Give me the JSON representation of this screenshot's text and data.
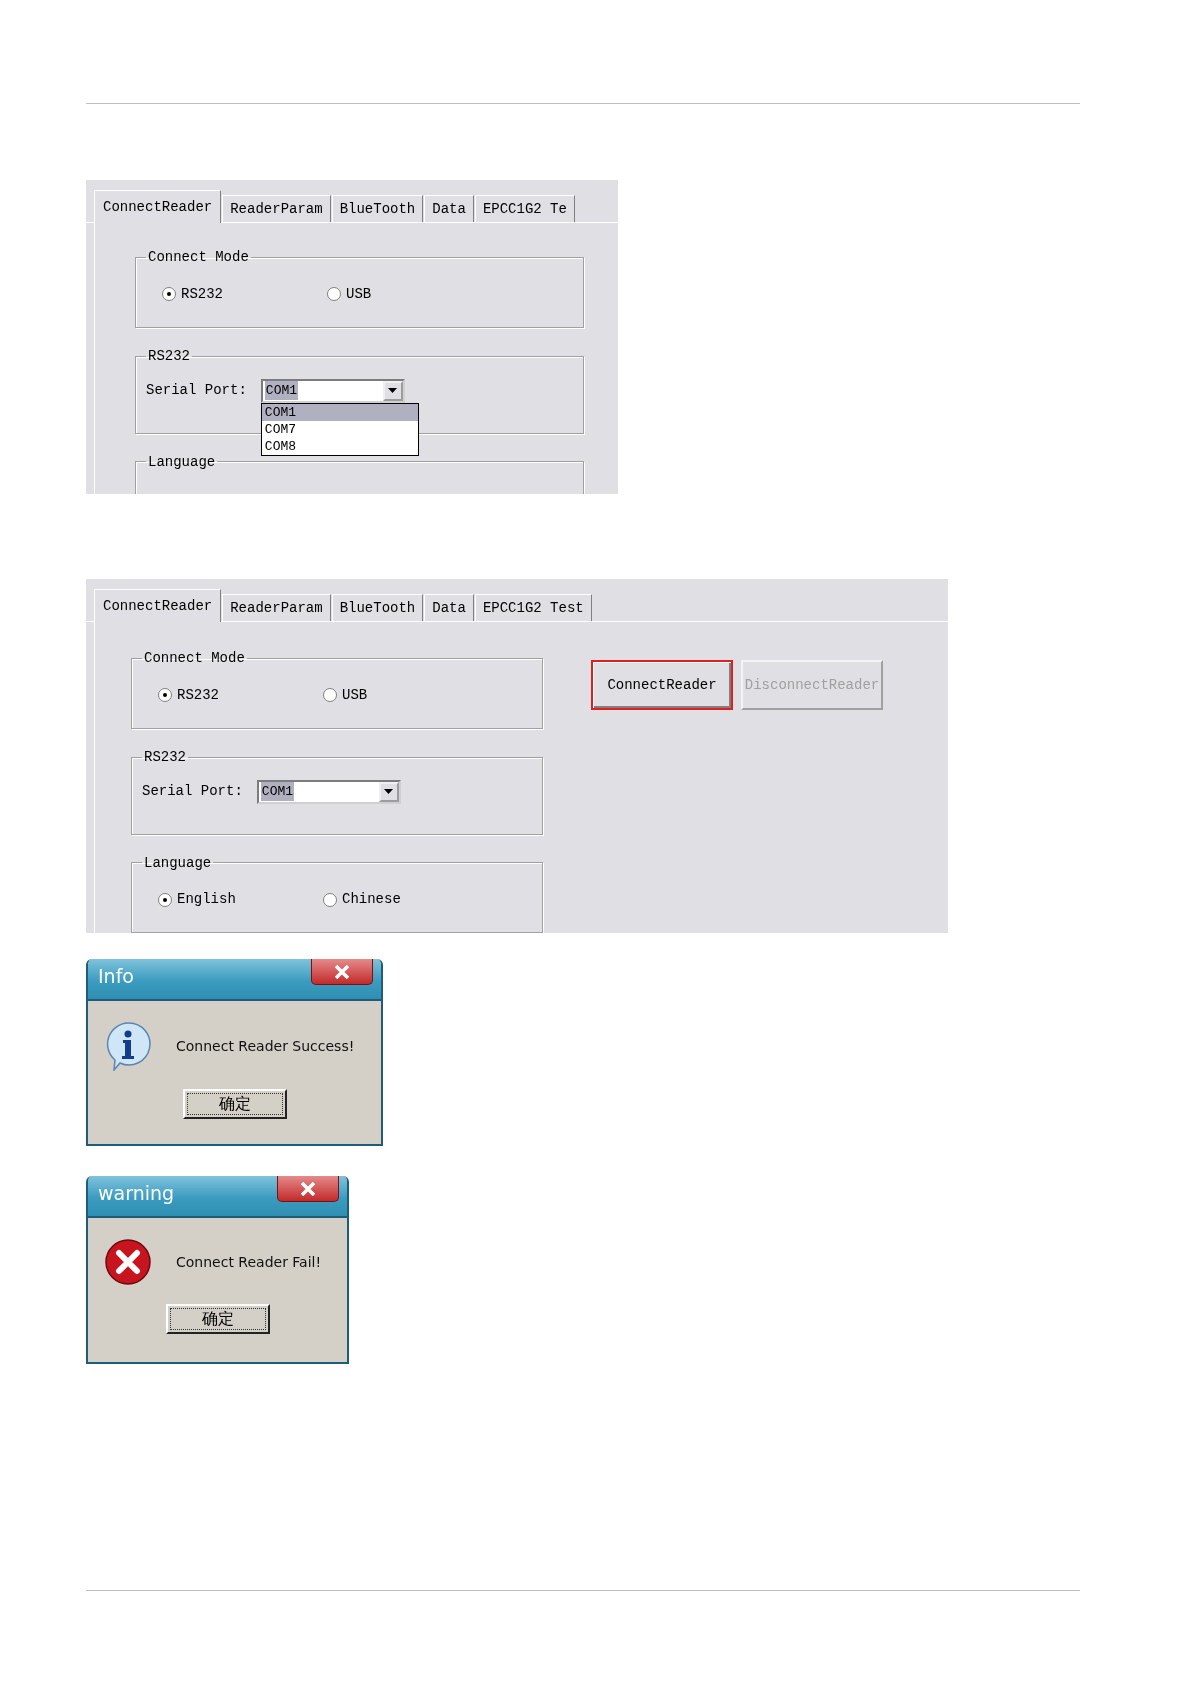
{
  "screenshots": [
    {
      "tabs": [
        {
          "label": "ConnectReader",
          "selected": true
        },
        {
          "label": "ReaderParam",
          "selected": false
        },
        {
          "label": "BlueTooth",
          "selected": false
        },
        {
          "label": "Data",
          "selected": false
        },
        {
          "label": "EPCC1G2 Te",
          "selected": false
        }
      ],
      "connect_mode": {
        "title": "Connect Mode",
        "options": [
          {
            "label": "RS232",
            "selected": true
          },
          {
            "label": "USB",
            "selected": false
          }
        ]
      },
      "rs232": {
        "title": "RS232",
        "label": "Serial Port:",
        "value": "COM1",
        "options": [
          {
            "label": "COM1",
            "selected": true
          },
          {
            "label": "COM7",
            "selected": false
          },
          {
            "label": "COM8",
            "selected": false
          }
        ]
      },
      "language": {
        "title": "Language"
      }
    },
    {
      "tabs": [
        {
          "label": "ConnectReader",
          "selected": true
        },
        {
          "label": "ReaderParam",
          "selected": false
        },
        {
          "label": "BlueTooth",
          "selected": false
        },
        {
          "label": "Data",
          "selected": false
        },
        {
          "label": "EPCC1G2 Test",
          "selected": false
        }
      ],
      "connect_mode": {
        "title": "Connect Mode",
        "options": [
          {
            "label": "RS232",
            "selected": true
          },
          {
            "label": "USB",
            "selected": false
          }
        ]
      },
      "rs232": {
        "title": "RS232",
        "label": "Serial Port:",
        "value": "COM1"
      },
      "language": {
        "title": "Language",
        "options": [
          {
            "label": "English",
            "selected": true
          },
          {
            "label": "Chinese",
            "selected": false
          }
        ]
      },
      "buttons": [
        {
          "label": "ConnectReader",
          "disabled": false,
          "highlighted": true
        },
        {
          "label": "DisconnectReader",
          "disabled": true,
          "highlighted": false
        }
      ]
    }
  ],
  "dialogs": [
    {
      "kind": "info",
      "title": "Info",
      "message": "Connect Reader Success!",
      "button": "确定"
    },
    {
      "kind": "error",
      "title": "warning",
      "message": "Connect Reader Fail!",
      "button": "确定"
    }
  ]
}
